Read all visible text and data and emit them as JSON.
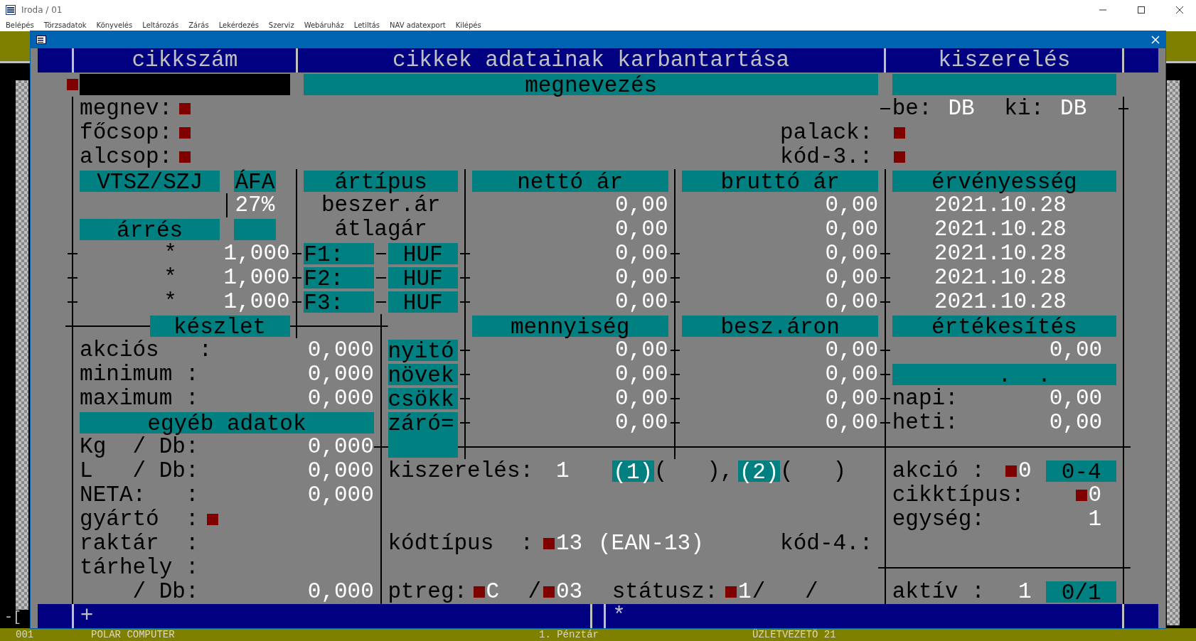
{
  "app": {
    "title": "Iroda / 01",
    "menu": [
      "Belépés",
      "Törzsadatok",
      "Könyvelés",
      "Leltározás",
      "Zárás",
      "Lekérdezés",
      "Szerviz",
      "Webáruház",
      "Letiltás",
      "NAV adatexport",
      "Kilépés"
    ],
    "edge_text": "-[",
    "status": [
      "001",
      "POLAR COMPUTER",
      "1. Pénztár",
      "ÜZLETVEZETŐ 21"
    ]
  },
  "form": {
    "headers": [
      "cikkszám",
      "cikkek adatainak karbantartása",
      "kiszerelés"
    ],
    "name_heading": "megnevezés",
    "name_fields": [
      {
        "label": "megnev:"
      },
      {
        "label": "főcsop:"
      },
      {
        "label": "alcsop:"
      }
    ],
    "units": [
      {
        "label": "be:",
        "value": "DB"
      },
      {
        "label": "ki:",
        "value": "DB"
      }
    ],
    "code_fields": [
      {
        "label": "palack:"
      },
      {
        "label": "kód-3.:"
      }
    ],
    "price_columns": [
      "VTSZ/SZJ",
      "ÁFA",
      "ártípus",
      "nettó ár",
      "bruttó ár",
      "érvényesség"
    ],
    "vat": "27%",
    "margin_heading": "árrés",
    "prices": [
      {
        "kind": "base",
        "type": "beszer.ár",
        "net": "0,00",
        "gross": "0,00",
        "valid_from": "2021.10.28"
      },
      {
        "kind": "base",
        "type": "átlagár",
        "net": "0,00",
        "gross": "0,00",
        "valid_from": "2021.10.28"
      },
      {
        "kind": "custom",
        "multiplier": "*",
        "factor": "1,000",
        "type": "F1:",
        "currency": "HUF",
        "net": "0,00",
        "gross": "0,00",
        "valid_from": "2021.10.28"
      },
      {
        "kind": "custom",
        "multiplier": "*",
        "factor": "1,000",
        "type": "F2:",
        "currency": "HUF",
        "net": "0,00",
        "gross": "0,00",
        "valid_from": "2021.10.28"
      },
      {
        "kind": "custom",
        "multiplier": "*",
        "factor": "1,000",
        "type": "F3:",
        "currency": "HUF",
        "net": "0,00",
        "gross": "0,00",
        "valid_from": "2021.10.28"
      }
    ],
    "stock_columns": [
      "készlet",
      "mennyiség",
      "besz.áron",
      "értékesítés"
    ],
    "stock": [
      {
        "label": "akciós   :",
        "value": "0,000"
      },
      {
        "label": "minimum :",
        "value": "0,000"
      },
      {
        "label": "maximum :",
        "value": "0,000"
      }
    ],
    "movements": [
      {
        "label": "nyitó",
        "quantity": "0,00",
        "value": "0,00"
      },
      {
        "label": "növek",
        "quantity": "0,00",
        "value": "0,00"
      },
      {
        "label": "csökk",
        "quantity": "0,00",
        "value": "0,00"
      },
      {
        "label": "záró=",
        "quantity": "0,00",
        "value": "0,00"
      }
    ],
    "sales": {
      "total": "0,00",
      "date": ".  .",
      "periods": [
        {
          "label": "napi:",
          "value": "0,00"
        },
        {
          "label": "heti:",
          "value": "0,00"
        }
      ]
    },
    "other_heading": "egyéb adatok",
    "other": [
      {
        "label": "Kg  / Db:",
        "value": "0,000",
        "marker": false
      },
      {
        "label": "L   / Db:",
        "value": "0,000",
        "marker": false
      },
      {
        "label": "NETA:   :",
        "value": "0,000",
        "marker": false
      },
      {
        "label": "gyártó  :",
        "marker": true
      },
      {
        "label": "raktár  :",
        "marker": false
      },
      {
        "label": "tárhely :",
        "marker": false
      },
      {
        "label": "    / Db:",
        "value": "0,000",
        "marker": false
      }
    ],
    "packaging": {
      "label": "kiszerelés:",
      "value": "1",
      "slots": [
        {
          "key": "(1)",
          "value": "(   ),"
        },
        {
          "key": "(2)",
          "value": "(   )"
        }
      ]
    },
    "code_type": {
      "label": "kódtípus  :",
      "value": "13",
      "note": "(EAN-13)"
    },
    "code4_label": "kód-4.:",
    "registers": [
      {
        "label": "ptreg:",
        "value": "C"
      },
      {
        "label": "/",
        "value": "03"
      },
      {
        "label": "státusz:",
        "value": "1",
        "suffix": "/   /"
      }
    ],
    "settings": [
      {
        "kind": "marked",
        "label": "akció :",
        "value": "0",
        "range": "0-4"
      },
      {
        "kind": "marked",
        "label": "cikktípus:",
        "value": "0"
      },
      {
        "kind": "plain",
        "label": "egység:",
        "value": "1"
      },
      {
        "kind": "plain",
        "label": "aktív :",
        "value": "1",
        "range": "0/1"
      }
    ],
    "footer": [
      "+",
      "*"
    ]
  }
}
